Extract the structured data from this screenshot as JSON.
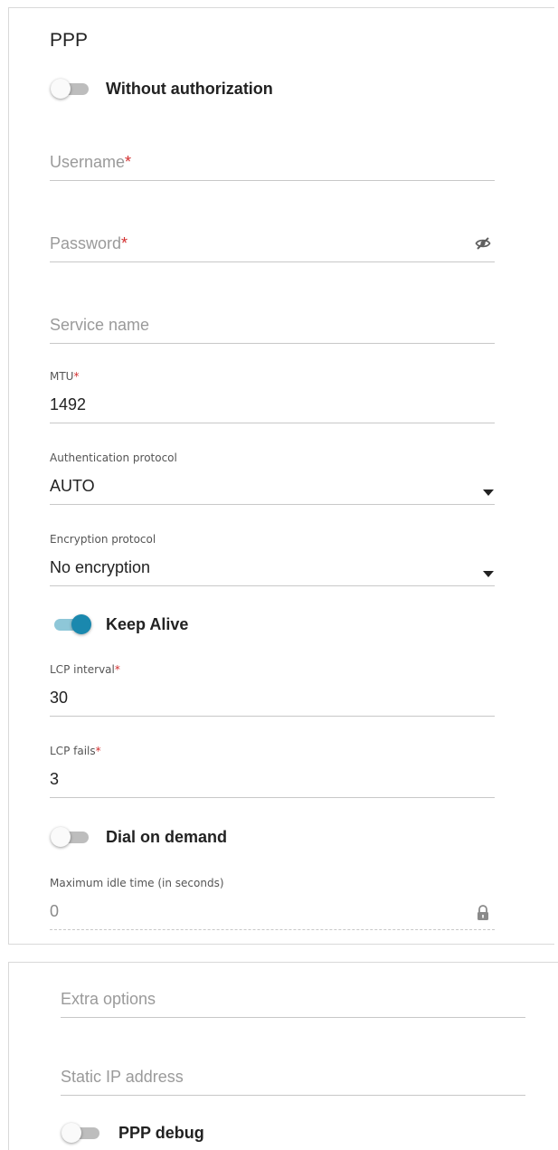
{
  "ppp": {
    "title": "PPP",
    "without_auth": {
      "label": "Without authorization",
      "checked": false
    },
    "username": {
      "label": "Username",
      "required_mark": "*",
      "value": ""
    },
    "password": {
      "label": "Password",
      "required_mark": "*",
      "value": "",
      "icon": "eye-slash-icon"
    },
    "service_name": {
      "label": "Service name",
      "value": ""
    },
    "mtu": {
      "label": "MTU",
      "required_mark": "*",
      "value": "1492"
    },
    "auth_protocol": {
      "label": "Authentication protocol",
      "value": "AUTO",
      "icon": "caret-down-icon"
    },
    "encryption_protocol": {
      "label": "Encryption protocol",
      "value": "No encryption",
      "icon": "caret-down-icon"
    },
    "keep_alive": {
      "label": "Keep Alive",
      "checked": true
    },
    "lcp_interval": {
      "label": "LCP interval",
      "required_mark": "*",
      "value": "30"
    },
    "lcp_fails": {
      "label": "LCP fails",
      "required_mark": "*",
      "value": "3"
    },
    "dial_on_demand": {
      "label": "Dial on demand",
      "checked": false
    },
    "max_idle_time": {
      "label": "Maximum idle time (in seconds)",
      "value": "0",
      "icon": "lock-icon"
    }
  },
  "extra": {
    "extra_options": {
      "label": "Extra options",
      "value": ""
    },
    "static_ip": {
      "label": "Static IP address",
      "value": ""
    },
    "ppp_debug": {
      "label": "PPP debug",
      "checked": false
    }
  },
  "colors": {
    "accent": "#1a88ae",
    "required": "#d32f2f"
  }
}
